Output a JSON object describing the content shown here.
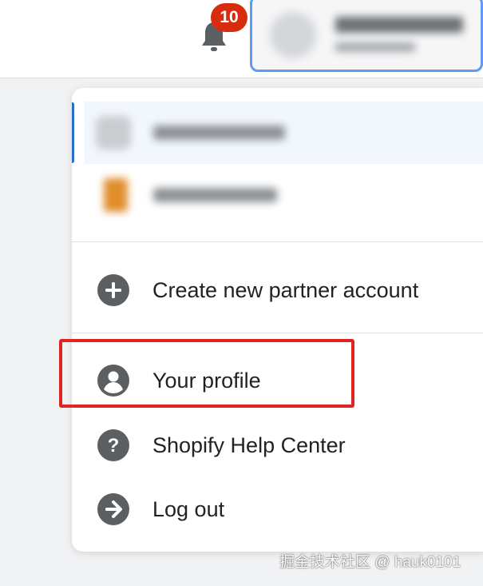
{
  "topbar": {
    "notifications": {
      "count": "10",
      "icon": "bell-icon"
    }
  },
  "account_menu": {
    "stores": [
      {
        "active": true,
        "thumb_color": "#c9ccd0"
      },
      {
        "active": false,
        "thumb_color": "#e08d2a"
      }
    ],
    "items": [
      {
        "label": "Create new partner account",
        "icon": "plus-circle-icon"
      },
      {
        "label": "Your profile",
        "icon": "profile-icon"
      },
      {
        "label": "Shopify Help Center",
        "icon": "help-circle-icon"
      },
      {
        "label": "Log out",
        "icon": "logout-arrow-icon"
      }
    ]
  },
  "watermark": "掘金技术社区 @ hauk0101",
  "colors": {
    "accent": "#2c6ecb",
    "badge": "#d72c0d",
    "highlight": "#e02424",
    "icon": "#5c5f62"
  }
}
